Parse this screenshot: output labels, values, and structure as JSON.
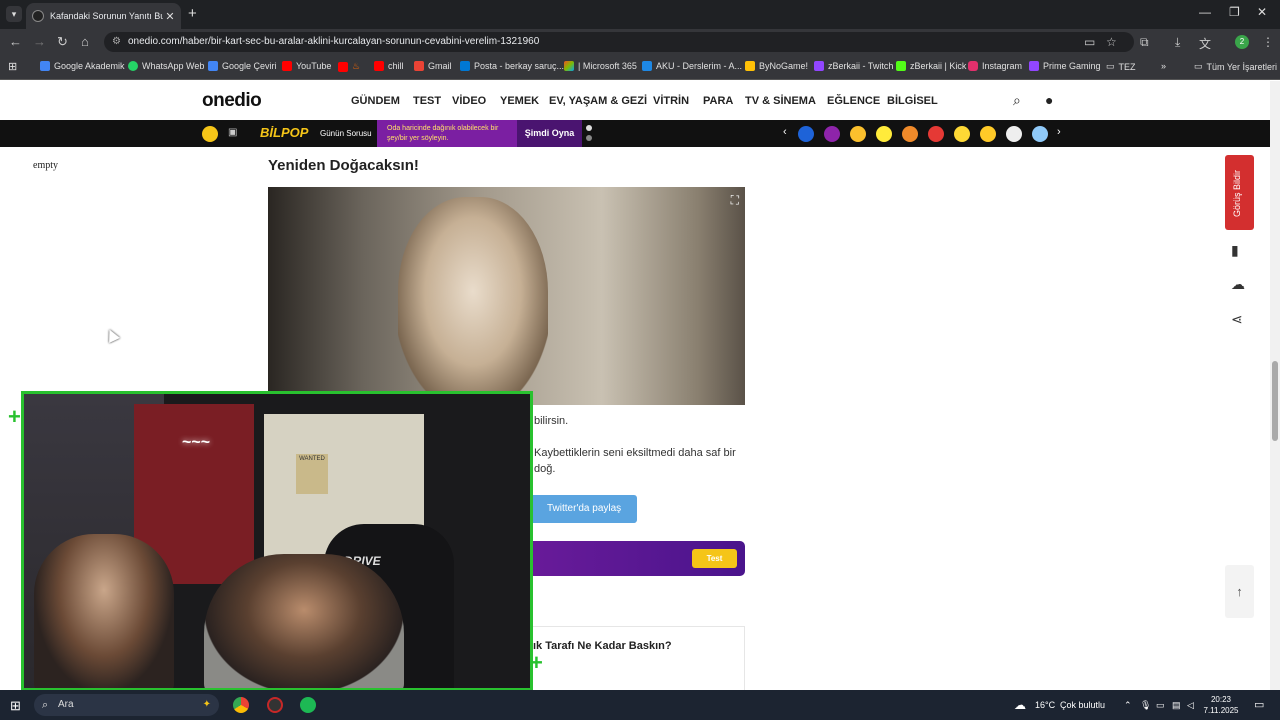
{
  "browser": {
    "tab_title": "Kafandaki Sorunun Yanıtı Bu Kart",
    "url": "onedio.com/haber/bir-kart-sec-bu-aralar-aklini-kurcalayan-sorunun-cevabini-verelim-1321960",
    "profile_initial": "2",
    "bookmarks": [
      {
        "label": "Google Akademik",
        "color": "#4285f4"
      },
      {
        "label": "WhatsApp Web",
        "color": "#25d366"
      },
      {
        "label": "Google Çeviri",
        "color": "#4285f4"
      },
      {
        "label": "YouTube",
        "color": "#ff0000"
      },
      {
        "label": "",
        "color": "#ff0000"
      },
      {
        "label": "chill",
        "color": "#ff0000"
      },
      {
        "label": "Gmail",
        "color": "#ea4335"
      },
      {
        "label": "Posta - berkay saruç...",
        "color": "#0078d4"
      },
      {
        "label": "| Microsoft 365",
        "color": "#f25022"
      },
      {
        "label": "AKU - Derslerim - A...",
        "color": "#1e88e5"
      },
      {
        "label": "ByNoGame!",
        "color": "#ffc107"
      },
      {
        "label": "zBerkaii - Twitch",
        "color": "#9146ff"
      },
      {
        "label": "zBerkaii | Kick",
        "color": "#53fc18"
      },
      {
        "label": "Instagram",
        "color": "#e1306c"
      },
      {
        "label": "Prime Gaming",
        "color": "#9146ff"
      },
      {
        "label": "TEZ",
        "color": "#cccccc"
      }
    ],
    "all_bookmarks_label": "Tüm Yer İşaretleri"
  },
  "site": {
    "logo": "onedio",
    "nav": [
      "GÜNDEM",
      "TEST",
      "VİDEO",
      "YEMEK",
      "EV, YAŞAM & GEZİ",
      "VİTRİN",
      "PARA",
      "TV & SİNEMA",
      "EĞLENCE",
      "BİLGİSEL"
    ],
    "gamebar": {
      "brand": "BİLPOP",
      "daily": "Günün Sorusu",
      "promo": "Oda haricinde dağınık olabilecek bir şey/bir yer söyleyin.",
      "cta": "Şimdi Oyna"
    }
  },
  "article": {
    "empty_label": "empty",
    "heading": "Yeniden Doğacaksın!",
    "line1": "bilirsin.",
    "line2": "Kaybettiklerin seni eksiltmedi  daha saf bir",
    "line3": "doğ.",
    "twitter_button": "Twitter'da paylaş",
    "test_badge": "Test",
    "quiz_title": "ık Tarafı Ne Kadar Baskın?"
  },
  "rail": {
    "feedback_label": "Görüş Bildir"
  },
  "webcam": {
    "wanted_text": "WANTED",
    "brand_text": "DRIVE"
  },
  "taskbar": {
    "search_placeholder": "Ara",
    "temperature": "16°C",
    "weather": "Çok bulutlu",
    "time": "20:23",
    "date": "7.11.2025"
  }
}
